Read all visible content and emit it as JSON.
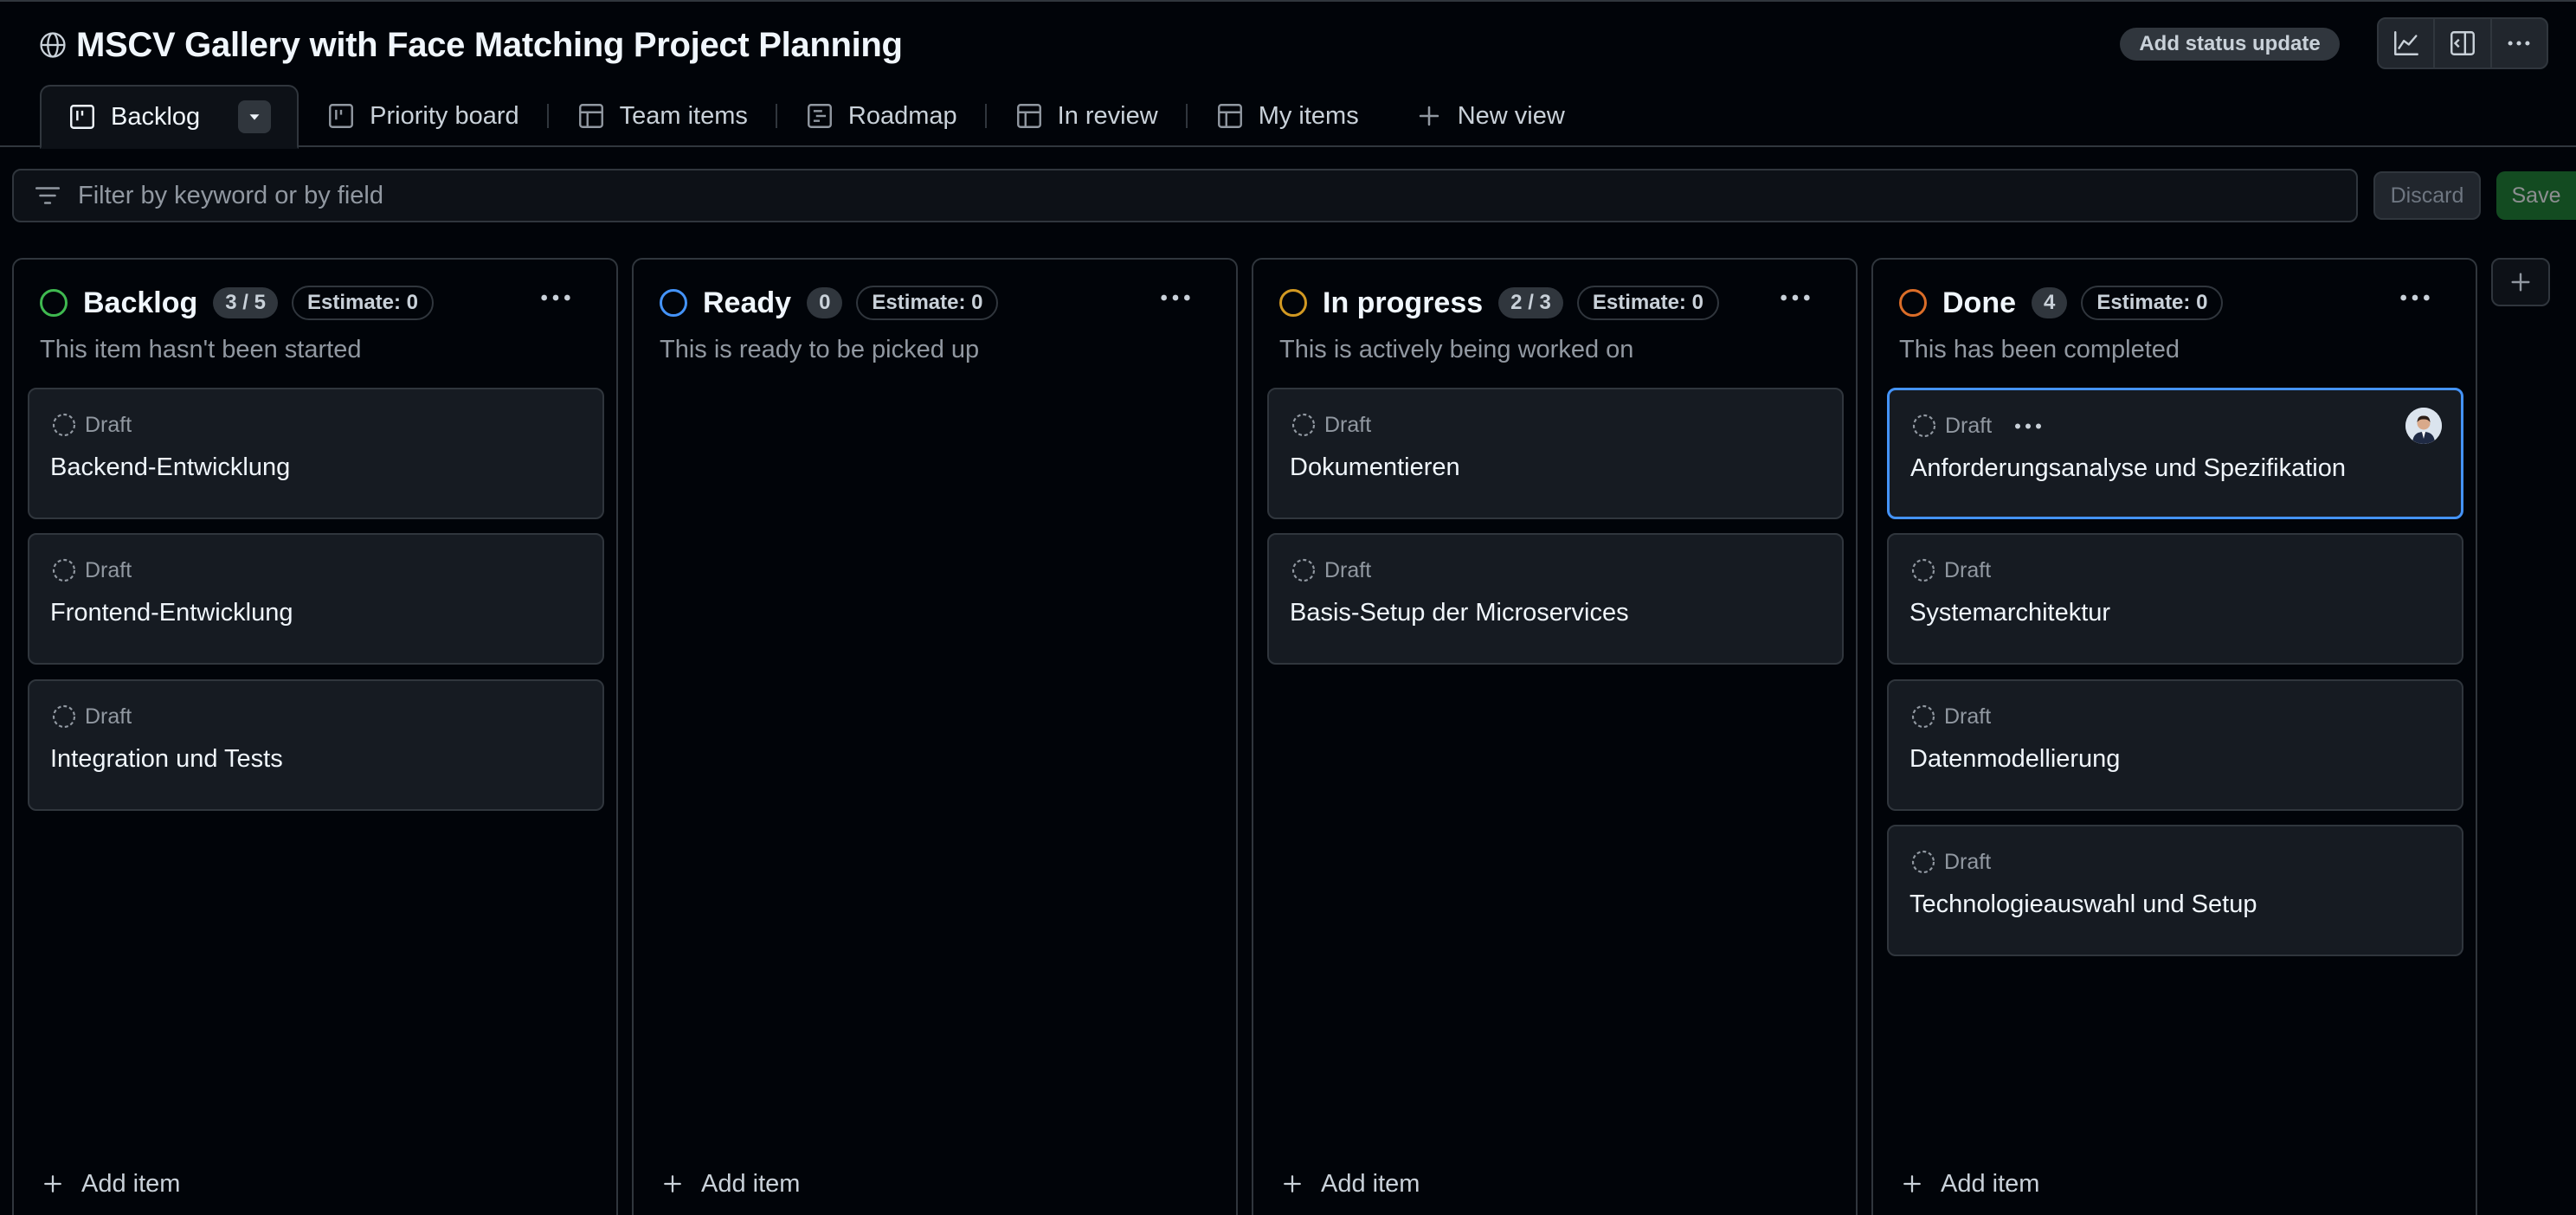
{
  "project": {
    "title": "MSCV Gallery with Face Matching Project Planning"
  },
  "header_actions": {
    "status_update_label": "Add status update",
    "icons": [
      "insights-icon",
      "side-panel-icon",
      "kebab-menu-icon"
    ]
  },
  "tabs": [
    {
      "label": "Backlog",
      "icon": "board-icon",
      "active": true
    },
    {
      "label": "Priority board",
      "icon": "board-icon",
      "active": false
    },
    {
      "label": "Team items",
      "icon": "table-icon",
      "active": false
    },
    {
      "label": "Roadmap",
      "icon": "roadmap-icon",
      "active": false
    },
    {
      "label": "In review",
      "icon": "table-icon",
      "active": false
    },
    {
      "label": "My items",
      "icon": "table-icon",
      "active": false
    },
    {
      "label": "New view",
      "icon": "plus-icon",
      "active": false
    }
  ],
  "filter": {
    "placeholder": "Filter by keyword or by field",
    "value": "",
    "discard_label": "Discard",
    "save_label": "Save"
  },
  "colors": {
    "backlog": "#3fb950",
    "ready": "#4493f8",
    "in_progress": "#d29922",
    "done": "#db6d28",
    "selected_border": "#4493f8"
  },
  "columns": [
    {
      "name": "Backlog",
      "count": "3 / 5",
      "estimate": "Estimate: 0",
      "description": "This item hasn't been started",
      "cards": [
        {
          "status": "Draft",
          "title": "Backend-Entwicklung"
        },
        {
          "status": "Draft",
          "title": "Frontend-Entwicklung"
        },
        {
          "status": "Draft",
          "title": "Integration und Tests"
        }
      ],
      "add_label": "Add item"
    },
    {
      "name": "Ready",
      "count": "0",
      "estimate": "Estimate: 0",
      "description": "This is ready to be picked up",
      "cards": [],
      "add_label": "Add item"
    },
    {
      "name": "In progress",
      "count": "2 / 3",
      "estimate": "Estimate: 0",
      "description": "This is actively being worked on",
      "cards": [
        {
          "status": "Draft",
          "title": "Dokumentieren"
        },
        {
          "status": "Draft",
          "title": "Basis-Setup der Microservices"
        }
      ],
      "add_label": "Add item"
    },
    {
      "name": "Done",
      "count": "4",
      "estimate": "Estimate: 0",
      "description": "This has been completed",
      "cards": [
        {
          "status": "Draft",
          "title": "Anforderungsanalyse und Spezifikation",
          "selected": true,
          "assignee_avatar": true
        },
        {
          "status": "Draft",
          "title": "Systemarchitektur"
        },
        {
          "status": "Draft",
          "title": "Datenmodellierung"
        },
        {
          "status": "Draft",
          "title": "Technologieauswahl und Setup"
        }
      ],
      "add_label": "Add item"
    }
  ]
}
